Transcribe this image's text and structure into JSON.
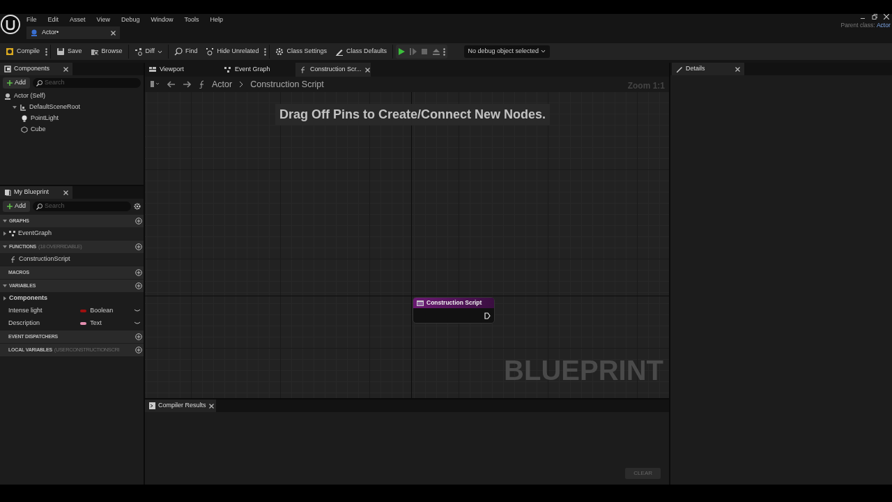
{
  "menu": [
    "File",
    "Edit",
    "Asset",
    "View",
    "Debug",
    "Window",
    "Tools",
    "Help"
  ],
  "document_tab": {
    "label": "Actor•",
    "selected": true
  },
  "parent_class": {
    "label": "Parent class:",
    "value": "Actor"
  },
  "toolbar": [
    {
      "kind": "button",
      "label": "Compile",
      "more": true
    },
    {
      "kind": "button",
      "label": "Save",
      "more": false
    },
    {
      "kind": "button",
      "label": "Browse",
      "more": false
    },
    {
      "kind": "dropdown",
      "label": "Diff",
      "more": false
    },
    {
      "kind": "button",
      "label": "Find",
      "more": false
    },
    {
      "kind": "button",
      "label": "Hide Unrelated",
      "more": true
    },
    {
      "kind": "button",
      "label": "Class Settings",
      "more": false
    },
    {
      "kind": "button",
      "label": "Class Defaults",
      "more": false
    },
    {
      "kind": "play",
      "more": true
    }
  ],
  "debug_selector": {
    "value": "No debug object selected"
  },
  "components_panel": {
    "tab": "Components",
    "add": "Add",
    "search": {
      "placeholder": "Search"
    },
    "tree": [
      {
        "label": "Actor (Self)",
        "children": [
          {
            "label": "DefaultSceneRoot",
            "expanded": true,
            "children": [
              {
                "label": "PointLight"
              },
              {
                "label": "Cube"
              }
            ]
          }
        ]
      }
    ]
  },
  "my_blueprint": {
    "tab": "My Blueprint",
    "add": "Add",
    "search": {
      "placeholder": "Search"
    },
    "sections": [
      {
        "title": "GRAPHS",
        "expanded": true,
        "items": [
          {
            "kind": "graph",
            "label": "EventGraph",
            "expanded": false
          }
        ]
      },
      {
        "title": "FUNCTIONS",
        "note": "(18 OVERRIDABLE)",
        "expanded": true,
        "items": [
          {
            "kind": "function",
            "label": "ConstructionScript"
          }
        ]
      },
      {
        "title": "MACROS",
        "expanded": false
      },
      {
        "title": "VARIABLES",
        "expanded": true,
        "items": [
          {
            "kind": "category",
            "label": "Components",
            "expanded": false
          },
          {
            "kind": "variable",
            "label": "Intense light",
            "type": "Boolean",
            "color": "#a01010"
          },
          {
            "kind": "variable",
            "label": "Description",
            "type": "Text",
            "color": "#e58fb0"
          }
        ]
      },
      {
        "title": "EVENT DISPATCHERS",
        "expanded": false
      },
      {
        "title": "LOCAL VARIABLES",
        "note": "(USERCONSTRUCTIONSCRI",
        "expanded": false
      }
    ]
  },
  "editor_tabs": [
    {
      "label": "Viewport",
      "selected": false,
      "closable": false
    },
    {
      "label": "Event Graph",
      "selected": false,
      "closable": false
    },
    {
      "label": "Construction Scr...",
      "selected": true,
      "closable": true
    }
  ],
  "breadcrumb": [
    "Actor",
    "Construction Script"
  ],
  "graph": {
    "zoom": "Zoom 1:1",
    "hint": "Drag Off Pins to Create/Connect New Nodes.",
    "watermark": "BLUEPRINT",
    "node": {
      "title": "Construction Script"
    }
  },
  "details_panel": {
    "tab": "Details"
  },
  "compiler_results": {
    "tab": "Compiler Results",
    "clear": {
      "label": "CLEAR",
      "disabled": true
    }
  }
}
